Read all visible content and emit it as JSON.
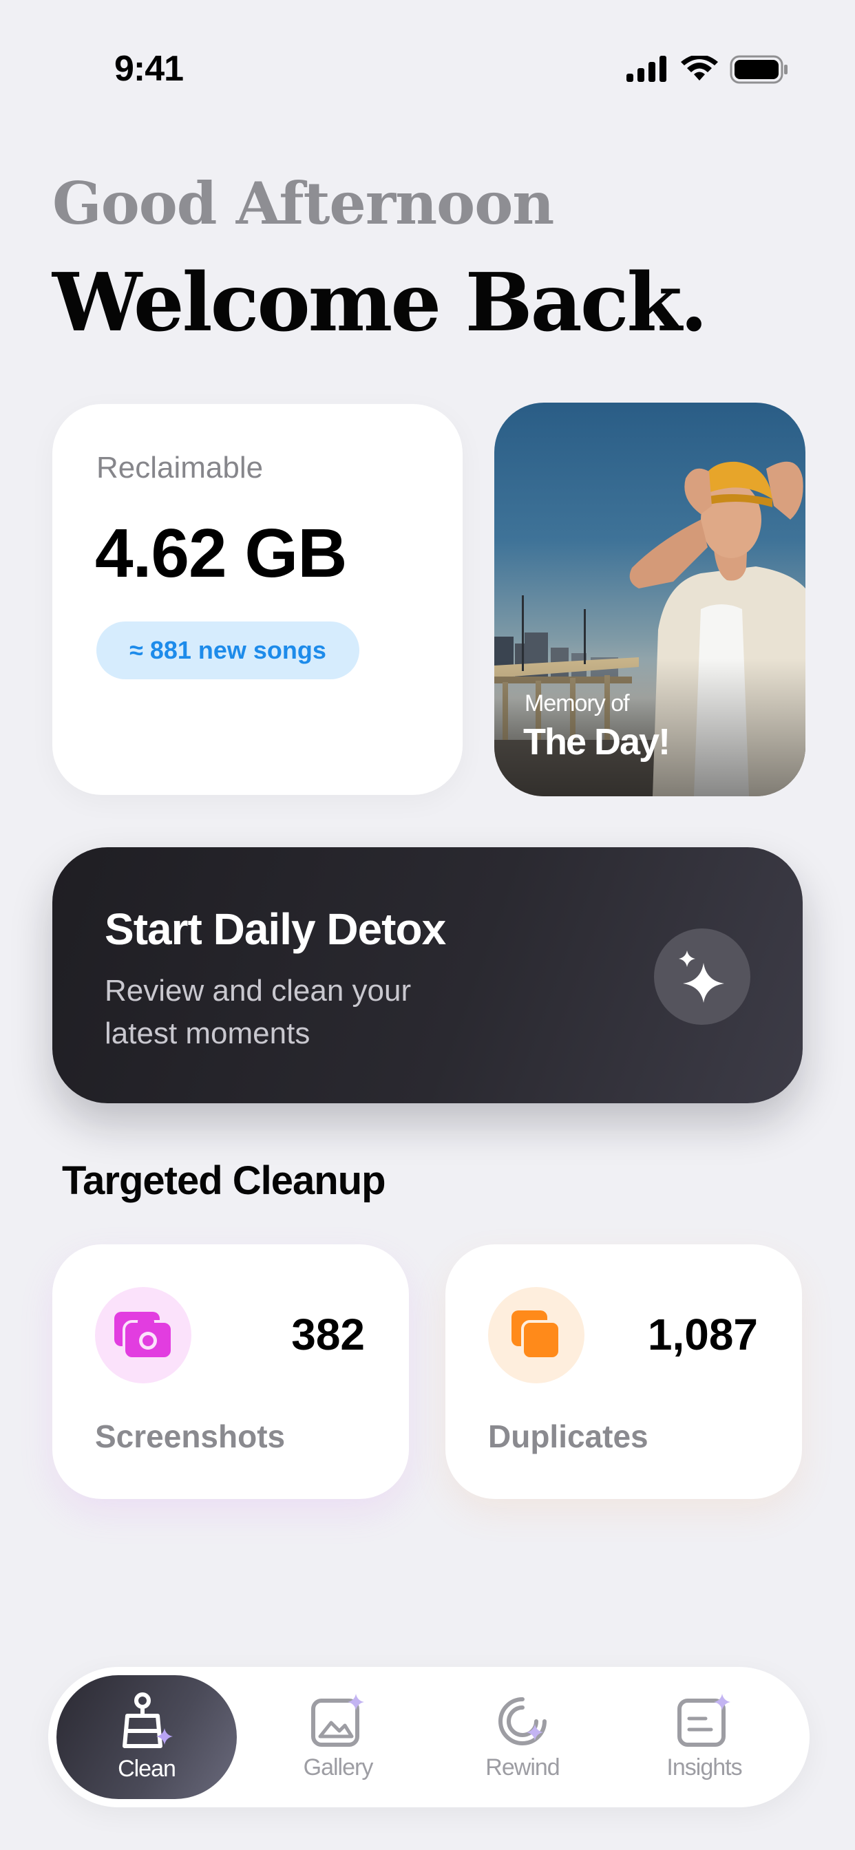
{
  "status_bar": {
    "time": "9:41"
  },
  "header": {
    "greeting": "Good Afternoon",
    "title": "Welcome Back."
  },
  "reclaim": {
    "label": "Reclaimable",
    "value": "4.62 GB",
    "badge": "≈ 881 new songs"
  },
  "memory": {
    "kicker": "Memory of",
    "title": "The Day!"
  },
  "detox": {
    "title": "Start Daily Detox",
    "subtitle": "Review and clean your latest moments",
    "icon": "sparkles-icon"
  },
  "targeted": {
    "title": "Targeted Cleanup",
    "items": [
      {
        "label": "Screenshots",
        "count": "382",
        "icon": "camera-icon",
        "color": "#e23de0"
      },
      {
        "label": "Duplicates",
        "count": "1,087",
        "icon": "duplicate-icon",
        "color": "#ff8a1a"
      }
    ]
  },
  "tabbar": {
    "tabs": [
      {
        "label": "Clean",
        "icon": "broom-icon",
        "active": true
      },
      {
        "label": "Gallery",
        "icon": "gallery-icon",
        "active": false
      },
      {
        "label": "Rewind",
        "icon": "rewind-icon",
        "active": false
      },
      {
        "label": "Insights",
        "icon": "insights-icon",
        "active": false
      }
    ]
  },
  "colors": {
    "background": "#f0f0f4",
    "badge_blue": "#1d8bea",
    "detox_dark": "#1f1e23"
  }
}
